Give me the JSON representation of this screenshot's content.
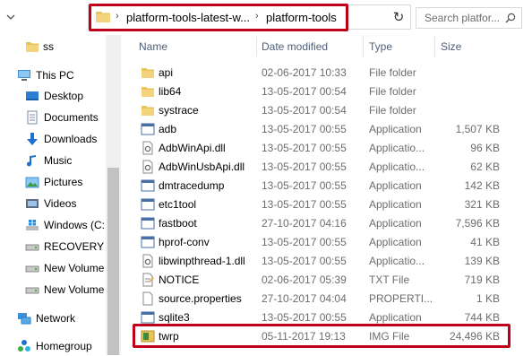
{
  "address": {
    "crumbs": [
      "platform-tools-latest-w...",
      "platform-tools"
    ],
    "search_placeholder": "Search platfor..."
  },
  "colors": {
    "highlight": "#c00018",
    "folder": "#e8c35a",
    "link_blue": "#1e6fd0"
  },
  "nav": {
    "items": [
      {
        "label": "ss",
        "icon": "folder-icon"
      },
      {
        "label": "This PC",
        "icon": "computer-icon"
      },
      {
        "label": "Desktop",
        "icon": "desktop-icon"
      },
      {
        "label": "Documents",
        "icon": "documents-icon"
      },
      {
        "label": "Downloads",
        "icon": "download-icon"
      },
      {
        "label": "Music",
        "icon": "music-icon"
      },
      {
        "label": "Pictures",
        "icon": "pictures-icon"
      },
      {
        "label": "Videos",
        "icon": "videos-icon"
      },
      {
        "label": "Windows (C:",
        "icon": "windows-drive-icon"
      },
      {
        "label": "RECOVERY (I",
        "icon": "drive-icon"
      },
      {
        "label": "New Volume",
        "icon": "drive-icon"
      },
      {
        "label": "New Volume",
        "icon": "drive-icon"
      },
      {
        "label": "Network",
        "icon": "network-icon"
      },
      {
        "label": "Homegroup",
        "icon": "homegroup-icon"
      }
    ]
  },
  "columns": {
    "name": "Name",
    "date": "Date modified",
    "type": "Type",
    "size": "Size"
  },
  "files": [
    {
      "name": "api",
      "date": "02-06-2017 10:33",
      "type": "File folder",
      "size": "",
      "icon": "folder-icon"
    },
    {
      "name": "lib64",
      "date": "13-05-2017 00:54",
      "type": "File folder",
      "size": "",
      "icon": "folder-icon"
    },
    {
      "name": "systrace",
      "date": "13-05-2017 00:54",
      "type": "File folder",
      "size": "",
      "icon": "folder-icon"
    },
    {
      "name": "adb",
      "date": "13-05-2017 00:55",
      "type": "Application",
      "size": "1,507 KB",
      "icon": "application-icon"
    },
    {
      "name": "AdbWinApi.dll",
      "date": "13-05-2017 00:55",
      "type": "Applicatio...",
      "size": "96 KB",
      "icon": "dll-icon"
    },
    {
      "name": "AdbWinUsbApi.dll",
      "date": "13-05-2017 00:55",
      "type": "Applicatio...",
      "size": "62 KB",
      "icon": "dll-icon"
    },
    {
      "name": "dmtracedump",
      "date": "13-05-2017 00:55",
      "type": "Application",
      "size": "142 KB",
      "icon": "application-icon"
    },
    {
      "name": "etc1tool",
      "date": "13-05-2017 00:55",
      "type": "Application",
      "size": "321 KB",
      "icon": "application-icon"
    },
    {
      "name": "fastboot",
      "date": "27-10-2017 04:16",
      "type": "Application",
      "size": "7,596 KB",
      "icon": "application-icon"
    },
    {
      "name": "hprof-conv",
      "date": "13-05-2017 00:55",
      "type": "Application",
      "size": "41 KB",
      "icon": "application-icon"
    },
    {
      "name": "libwinpthread-1.dll",
      "date": "13-05-2017 00:55",
      "type": "Applicatio...",
      "size": "139 KB",
      "icon": "dll-icon"
    },
    {
      "name": "NOTICE",
      "date": "02-06-2017 05:39",
      "type": "TXT File",
      "size": "719 KB",
      "icon": "text-file-icon"
    },
    {
      "name": "source.properties",
      "date": "27-10-2017 04:04",
      "type": "PROPERTI...",
      "size": "1 KB",
      "icon": "document-icon"
    },
    {
      "name": "sqlite3",
      "date": "13-05-2017 00:55",
      "type": "Application",
      "size": "744 KB",
      "icon": "application-icon"
    },
    {
      "name": "twrp",
      "date": "05-11-2017 19:13",
      "type": "IMG File",
      "size": "24,496 KB",
      "icon": "image-file-icon"
    }
  ]
}
